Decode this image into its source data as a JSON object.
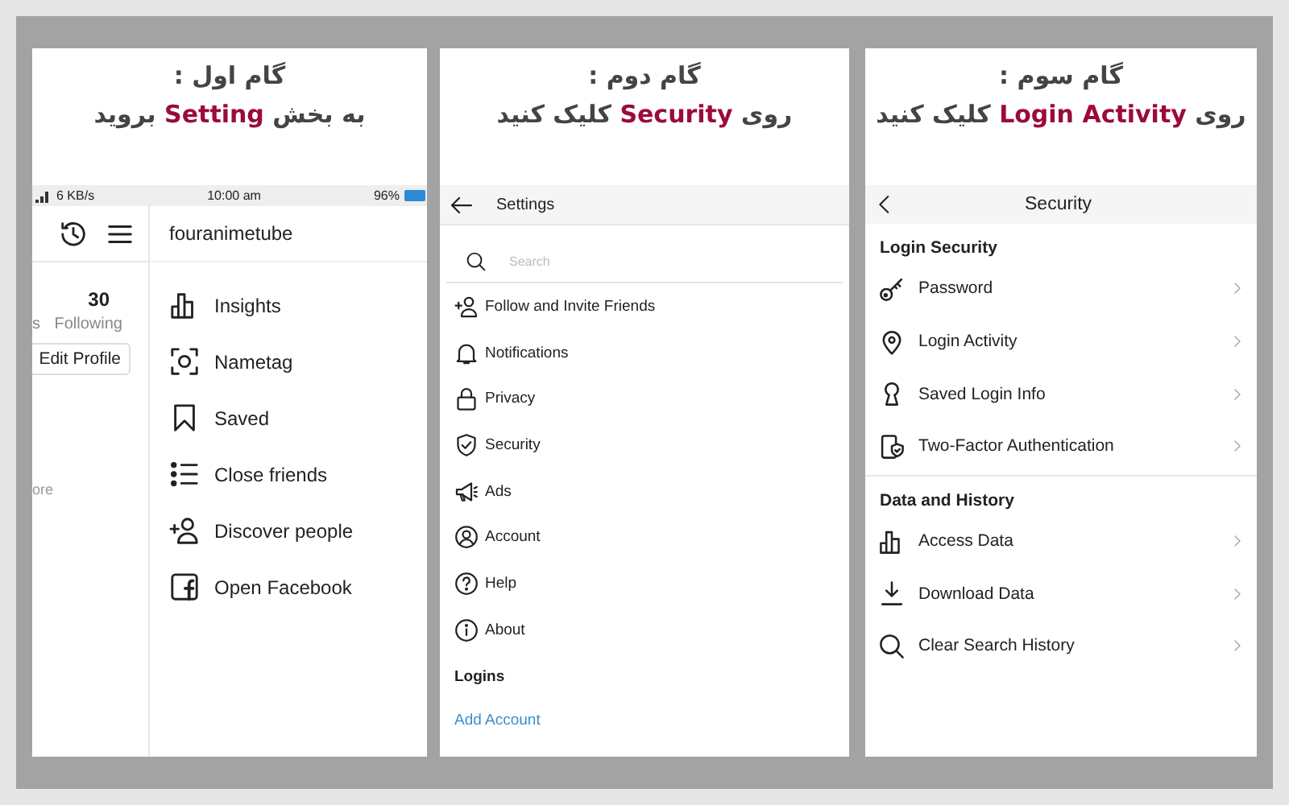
{
  "left_panel": {
    "title": "گام اول :",
    "instruction": "به بخش **Setting** بروید",
    "status_bar": {
      "speed": "6 KB/s",
      "time": "10:00 am",
      "battery": "96%"
    },
    "profile": {
      "count": "30",
      "stat_cut": "s",
      "stat_label": "Following",
      "button": "Edit Profile",
      "text_cut": "ore"
    },
    "drawer": {
      "username": "fouranimetube",
      "items": [
        "Insights",
        "Nametag",
        "Saved",
        "Close friends",
        "Discover people",
        "Open Facebook"
      ]
    }
  },
  "middle_panel": {
    "title": "گام دوم :",
    "instruction": "روی **Security** کلیک کنید",
    "header": "Settings",
    "search": {
      "placeholder": "Search"
    },
    "items": [
      "Follow and Invite Friends",
      "Notifications",
      "Privacy",
      "Security",
      "Ads",
      "Account",
      "Help",
      "About"
    ],
    "section": "Logins",
    "link": "Add Account"
  },
  "right_panel": {
    "title": "گام سوم :",
    "instruction": "روی **Login Activity** کلیک کنید",
    "header": "Security",
    "sections": [
      {
        "heading": "Login Security",
        "items": [
          "Password",
          "Login Activity",
          "Saved Login Info",
          "Two-Factor Authentication"
        ]
      },
      {
        "heading": "Data and History",
        "items": [
          "Access Data",
          "Download Data",
          "Clear Search History"
        ]
      }
    ]
  }
}
